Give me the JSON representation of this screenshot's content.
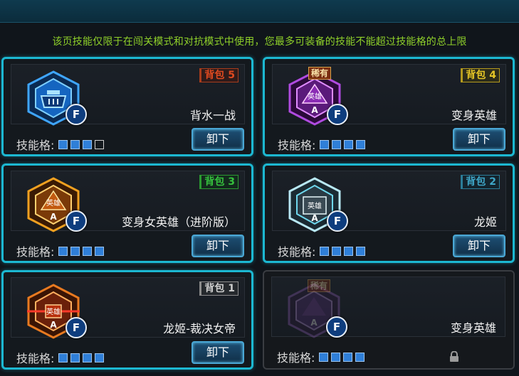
{
  "notice": "该页技能仅限于在闯关模式和对抗模式中使用，您最多可装备的技能不能超过技能格的总上限",
  "slot_label": "技能格:",
  "unload_label": "卸下",
  "f_key": "F",
  "rare_label": "稀有",
  "cards": [
    {
      "badge": "背包 5",
      "badge_color": "red",
      "name": "背水一战",
      "slots": [
        true,
        true,
        true,
        false
      ],
      "icon": "blue-hexagon-skill-icon",
      "emblem": "",
      "emblem_sub": "",
      "rare": false
    },
    {
      "badge": "背包 4",
      "badge_color": "yellow",
      "name": "变身英雄",
      "slots": [
        true,
        true,
        true,
        true
      ],
      "icon": "purple-hero-transform-icon",
      "emblem": "英雄",
      "emblem_sub": "A",
      "rare": true
    },
    {
      "badge": "背包 3",
      "badge_color": "green",
      "name": "变身女英雄（进阶版）",
      "slots": [
        true,
        true,
        true,
        true
      ],
      "icon": "orange-heroine-transform-icon",
      "emblem": "英雄",
      "emblem_sub": "A",
      "rare": false
    },
    {
      "badge": "背包 2",
      "badge_color": "blue",
      "name": "龙姬",
      "slots": [
        true,
        true,
        true,
        true
      ],
      "icon": "silver-dragon-princess-icon",
      "emblem": "英雄",
      "emblem_sub": "A",
      "rare": false
    },
    {
      "badge": "背包 1",
      "badge_color": "gray",
      "name": "龙姬-裁决女帝",
      "slots": [
        true,
        true,
        true,
        true
      ],
      "icon": "red-judgment-empress-icon",
      "emblem": "英雄",
      "emblem_sub": "A",
      "rare": false
    },
    {
      "badge": "",
      "badge_color": "",
      "name": "变身英雄",
      "slots": [
        true,
        true,
        true,
        true
      ],
      "icon": "faded-hero-transform-icon",
      "emblem": "",
      "emblem_sub": "A",
      "rare": true,
      "locked": true
    }
  ]
}
